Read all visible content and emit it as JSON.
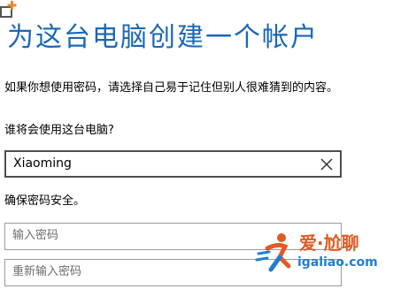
{
  "title": "为这台电脑创建一个帐户",
  "subtitle": "如果你想使用密码，请选择自己易于记住但别人很难猜到的内容。",
  "username": {
    "question": "谁将会使用这台电脑?",
    "value": "Xiaoming"
  },
  "password": {
    "section_label": "确保密码安全。",
    "password_placeholder": "输入密码",
    "confirm_placeholder": "重新输入密码"
  },
  "watermark": {
    "top_text": "爱·尬聊",
    "bottom_text": "igaliao.com"
  },
  "colors": {
    "title": "#1a67b5",
    "watermark_orange": "#e05a24",
    "watermark_blue": "#1f7fcf"
  },
  "icons": {
    "corner": "add-window-icon",
    "clear": "clear-x-icon"
  }
}
